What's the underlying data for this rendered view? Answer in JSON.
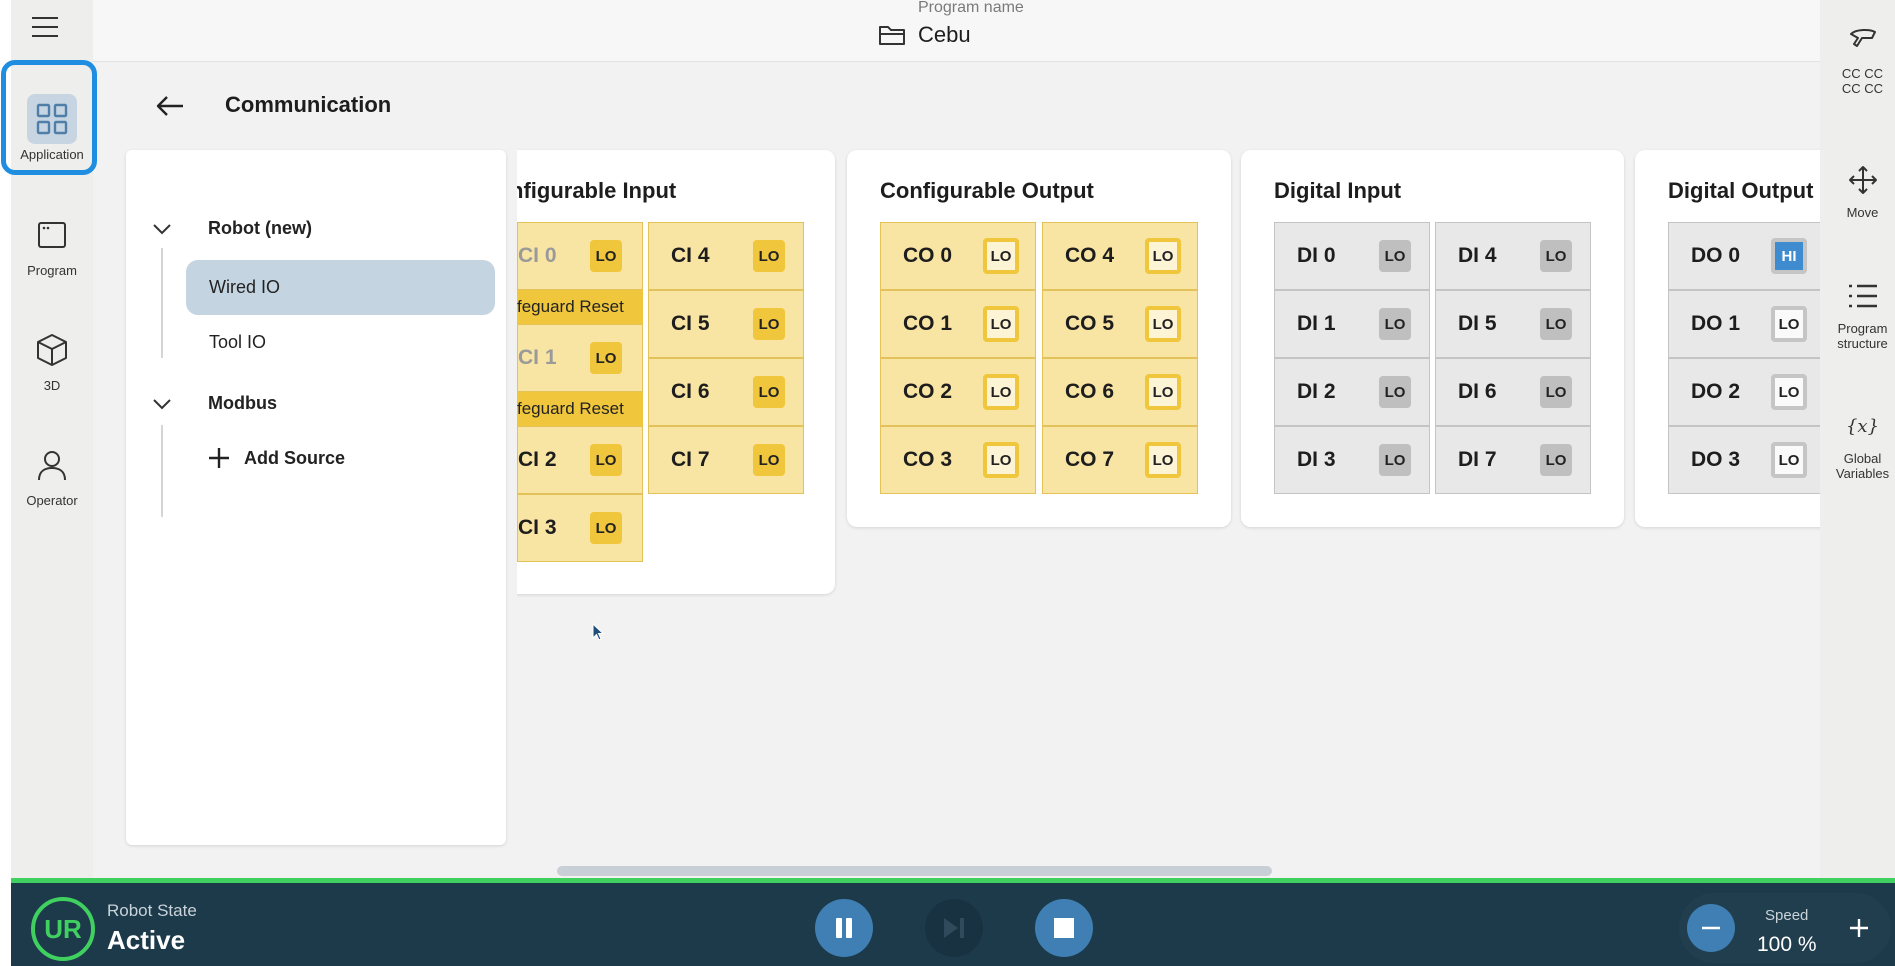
{
  "left_rail": {
    "items": [
      {
        "label": "Application",
        "icon": "grid-icon",
        "active": true
      },
      {
        "label": "Program",
        "icon": "program-window-icon"
      },
      {
        "label": "3D",
        "icon": "cube-icon"
      },
      {
        "label": "Operator",
        "icon": "person-icon"
      }
    ]
  },
  "top_bar": {
    "program_label": "Program name",
    "program_value": "Cebu"
  },
  "right_rail": {
    "items": [
      {
        "label": "CC CC\nCC CC",
        "icon": "tool-icon"
      },
      {
        "label": "Move",
        "icon": "move-arrows-icon"
      },
      {
        "label": "Program\nstructure",
        "icon": "list-icon"
      },
      {
        "label": "Global\nVariables",
        "icon": "variable-x-icon"
      }
    ]
  },
  "page": {
    "title": "Communication"
  },
  "tree": {
    "groups": [
      {
        "label": "Robot (new)",
        "children": [
          "Wired IO",
          "Tool IO"
        ]
      },
      {
        "label": "Modbus",
        "children": [
          "Add Source"
        ]
      }
    ],
    "selected": "Wired IO"
  },
  "cards": {
    "configurable_input": {
      "title": "Configurable Input",
      "visible_title": "nfigurable Input",
      "col1": [
        {
          "name": "CI 0",
          "visible_name": "CI 0",
          "state": "LO",
          "sub": "Safeguard Reset",
          "visible_sub": "feguard Reset"
        },
        {
          "name": "CI 1",
          "visible_name": "CI 1",
          "state": "LO",
          "sub": "Safeguard Reset",
          "visible_sub": "feguard Reset"
        },
        {
          "name": "CI 2",
          "visible_name": "CI 2",
          "state": "LO"
        },
        {
          "name": "CI 3",
          "visible_name": "CI 3",
          "state": "LO"
        }
      ],
      "col2": [
        {
          "name": "CI 4",
          "state": "LO"
        },
        {
          "name": "CI 5",
          "state": "LO"
        },
        {
          "name": "CI 6",
          "state": "LO"
        },
        {
          "name": "CI 7",
          "state": "LO"
        }
      ]
    },
    "configurable_output": {
      "title": "Configurable Output",
      "col1": [
        {
          "name": "CO 0",
          "state": "LO"
        },
        {
          "name": "CO 1",
          "state": "LO"
        },
        {
          "name": "CO 2",
          "state": "LO"
        },
        {
          "name": "CO 3",
          "state": "LO"
        }
      ],
      "col2": [
        {
          "name": "CO 4",
          "state": "LO"
        },
        {
          "name": "CO 5",
          "state": "LO"
        },
        {
          "name": "CO 6",
          "state": "LO"
        },
        {
          "name": "CO 7",
          "state": "LO"
        }
      ]
    },
    "digital_input": {
      "title": "Digital Input",
      "col1": [
        {
          "name": "DI 0",
          "state": "LO"
        },
        {
          "name": "DI 1",
          "state": "LO"
        },
        {
          "name": "DI 2",
          "state": "LO"
        },
        {
          "name": "DI 3",
          "state": "LO"
        }
      ],
      "col2": [
        {
          "name": "DI 4",
          "state": "LO"
        },
        {
          "name": "DI 5",
          "state": "LO"
        },
        {
          "name": "DI 6",
          "state": "LO"
        },
        {
          "name": "DI 7",
          "state": "LO"
        }
      ]
    },
    "digital_output": {
      "title": "Digital Output",
      "col1": [
        {
          "name": "DO 0",
          "state": "HI"
        },
        {
          "name": "DO 1",
          "state": "LO"
        },
        {
          "name": "DO 2",
          "state": "LO"
        },
        {
          "name": "DO 3",
          "state": "LO"
        }
      ]
    }
  },
  "bottom_bar": {
    "logo": "UR",
    "robot_state_label": "Robot State",
    "robot_state_value": "Active",
    "speed_label": "Speed",
    "speed_value": "100 %",
    "colors": {
      "bar": "#1c3a4a",
      "accent_green": "#3fd060",
      "pause": "#3f7fb3",
      "stop": "#3f7fb3"
    }
  },
  "colors": {
    "active_ring": "#1f8de0",
    "tree_selected": "#c5d4e1",
    "configurable_cell": "#f8e4a3",
    "configurable_badge": "#f0c63c",
    "digital_cell": "#e8e8e8",
    "hi_badge": "#3f8bd0"
  }
}
